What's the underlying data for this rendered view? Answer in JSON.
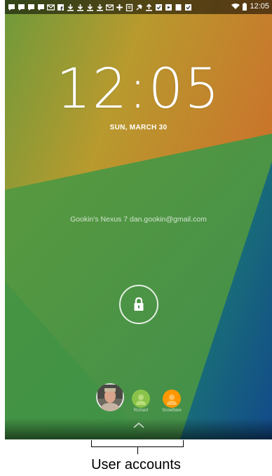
{
  "status_bar": {
    "time": "12:05",
    "notification_icons": [
      "chat-icon",
      "chat-icon",
      "chat-icon",
      "chat-icon",
      "mail-icon",
      "facebook-icon",
      "download-icon",
      "download-icon",
      "download-icon",
      "download-icon",
      "mail-icon",
      "plus-icon",
      "clipboard-icon",
      "pin-icon",
      "upload-icon",
      "check-icon",
      "play-icon",
      "barcode-icon",
      "check-icon"
    ],
    "wifi_icon": "wifi-icon",
    "battery_icon": "battery-icon"
  },
  "lock_screen": {
    "clock": "12:05",
    "date": "SUN, MARCH 30",
    "owner_info": "Gookin's Nexus 7 dan.gookin@gmail.com",
    "unlock_icon": "lock-icon"
  },
  "users": [
    {
      "name": "",
      "avatar_color": "#8a7a66"
    },
    {
      "name": "Richard",
      "avatar_color": "#8bc34a"
    },
    {
      "name": "Snowflake",
      "avatar_color": "#ff9800"
    }
  ],
  "annotation": {
    "caption": "User accounts"
  },
  "colors": {
    "wallpaper_top": "#c89a2a",
    "wallpaper_green": "#4a9e47",
    "wallpaper_blue": "#1e5aa0"
  }
}
